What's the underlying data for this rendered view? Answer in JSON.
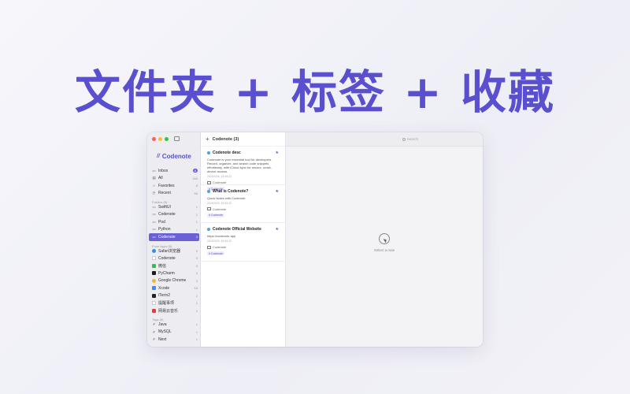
{
  "headline": "文件夹 + 标签 + 收藏",
  "colors": {
    "accent": "#5a4fcf",
    "traffic_red": "#ff5f57",
    "traffic_yellow": "#febc2e",
    "traffic_green": "#28c840"
  },
  "sidebar": {
    "brand": {
      "logo": "//",
      "name": "Codenote"
    },
    "smart": [
      {
        "label": "Inbox",
        "count": "6",
        "icon": "inbox-icon",
        "badge": true
      },
      {
        "label": "All",
        "count": "160",
        "icon": "tray-icon"
      },
      {
        "label": "Favorites",
        "count": "8",
        "icon": "star-icon"
      },
      {
        "label": "Recent",
        "count": "56",
        "icon": "clock-icon"
      }
    ],
    "folders_title": "Folders (9)",
    "folders": [
      {
        "label": "SwiftUI",
        "count": "1"
      },
      {
        "label": "Codenote",
        "count": "1"
      },
      {
        "label": "Pod",
        "count": "1"
      },
      {
        "label": "Python",
        "count": "1"
      },
      {
        "label": "Codenote",
        "count": "3",
        "active": true
      }
    ],
    "apps_title": "From Apps (9)",
    "apps": [
      {
        "label": "Safari浏览器",
        "count": "5",
        "color": "#2f8ef0"
      },
      {
        "label": "Codenote",
        "count": "5",
        "color": "#ffffff"
      },
      {
        "label": "微信",
        "count": "3",
        "color": "#2bc24c"
      },
      {
        "label": "PyCharm",
        "count": "2",
        "color": "#1c1c1c"
      },
      {
        "label": "Google Chrome",
        "count": "3",
        "color": "#e9b93a"
      },
      {
        "label": "Xcode",
        "count": "16",
        "color": "#3a8ef5"
      },
      {
        "label": "iTerm2",
        "count": "2",
        "color": "#222222"
      },
      {
        "label": "提醒事项",
        "count": "1",
        "color": "#ffffff"
      },
      {
        "label": "网易云音乐",
        "count": "1",
        "color": "#e33d3d"
      }
    ],
    "tags_title": "Tags (6)",
    "tags": [
      {
        "label": "Java",
        "count": "1"
      },
      {
        "label": "MySQL",
        "count": "1"
      },
      {
        "label": "Next",
        "count": "1"
      }
    ]
  },
  "notes": {
    "header": "Codenote (3)",
    "items": [
      {
        "title": "Codenote desc",
        "body": "Codenote is your essential tool for developers. Record, organize, and search code snippets effortlessly, with iCloud sync for secure, cross-device access.",
        "date": "2025/4/26, 18:49:22",
        "folder": "Codenote",
        "tag": "# Codenote"
      },
      {
        "title": "What is Codenote?",
        "body": "Quick Notes with Codenote",
        "date": "2025/4/26, 18:49:22",
        "folder": "Codenote",
        "tag": "# Codenote"
      },
      {
        "title": "Codenote Official Website",
        "body": "https://codenote.app",
        "date": "2025/4/26, 18:49:22",
        "folder": "Codenote",
        "tag": "# Codenote"
      }
    ]
  },
  "detail": {
    "search_placeholder": "Search",
    "empty_text": "Select a note"
  }
}
